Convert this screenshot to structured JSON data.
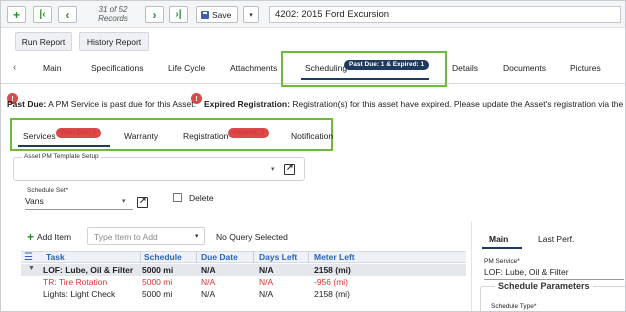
{
  "toolbar": {
    "record_line1": "31 of 52",
    "record_line2": "Records",
    "save_label": "Save",
    "asset_title": "4202: 2015 Ford Excursion"
  },
  "reports": {
    "run_report": "Run Report",
    "history_report": "History Report"
  },
  "main_tabs": [
    {
      "label": "Main"
    },
    {
      "label": "Specifications"
    },
    {
      "label": "Life Cycle"
    },
    {
      "label": "Attachments"
    },
    {
      "label": "Scheduling",
      "badge": "Past Due: 1 & Expired: 1",
      "active": true
    },
    {
      "label": "Details"
    },
    {
      "label": "Documents"
    },
    {
      "label": "Pictures"
    }
  ],
  "alerts": {
    "past_due_title": "Past Due:",
    "past_due_text": " A PM Service is past due for this Asset.",
    "expired_title": "Expired Registration:",
    "expired_text": " Registration(s) for this asset have expired. Please update the Asset's registration via the Registratio"
  },
  "sub_tabs": [
    {
      "label": "Services",
      "badge": "Past Due: 1",
      "active": true
    },
    {
      "label": "Warranty"
    },
    {
      "label": "Registration",
      "badge": "Expired: 1"
    },
    {
      "label": "Notification"
    }
  ],
  "pm_template": {
    "label": "Asset PM Template Setup",
    "value": ""
  },
  "schedule_set": {
    "label": "Schedule Set*",
    "value": "Vans"
  },
  "delete_label": "Delete",
  "grid_toolbar": {
    "add_item": "Add Item",
    "type_placeholder": "Type Item to Add",
    "query_status": "No Query Selected"
  },
  "grid": {
    "headers": [
      "Task",
      "Schedule",
      "Due Date",
      "Days Left",
      "Meter Left"
    ],
    "group": {
      "task": "LOF: Lube, Oil & Filter",
      "schedule": "5000 mi",
      "due": "N/A",
      "days": "N/A",
      "meter": "2158 (mi)"
    },
    "rows": [
      {
        "task": "TR: Tire Rotation",
        "schedule": "5000 mi",
        "due": "N/A",
        "days": "N/A",
        "meter": "-956 (mi)",
        "overdue": true
      },
      {
        "task": "Lights: Light Check",
        "schedule": "5000 mi",
        "due": "N/A",
        "days": "N/A",
        "meter": "2158 (mi)",
        "overdue": false
      }
    ]
  },
  "right_panel": {
    "tabs": [
      "Main",
      "Last Perf."
    ],
    "pm_service_label": "PM Service*",
    "pm_service_value": "LOF: Lube, Oil & Filter",
    "section_title": "Schedule Parameters",
    "schedule_type_label": "Schedule Type*"
  },
  "colors": {
    "accent_green": "#6cbb3c",
    "badge_navy": "#1e3a5f",
    "alert_red": "#d94b4b",
    "header_blue": "#2a63b8"
  }
}
